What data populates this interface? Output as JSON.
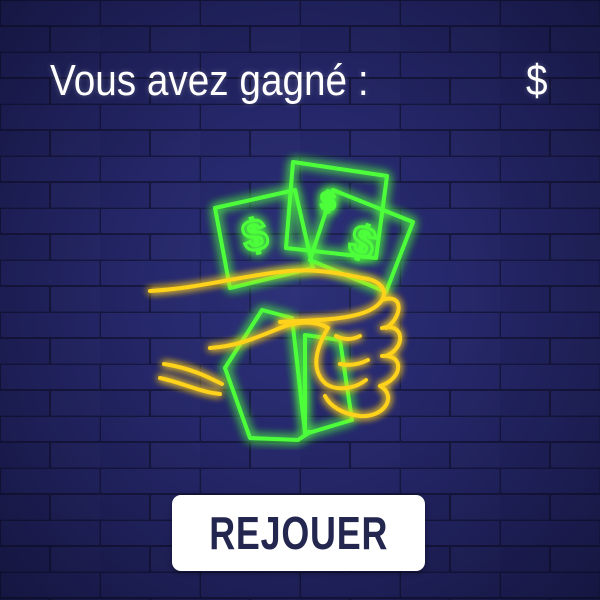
{
  "header": {
    "win_label": "Vous avez gagné :",
    "amount": "",
    "currency": "$"
  },
  "illustration": {
    "icon": "neon-hand-holding-money-icon",
    "bill_symbol": "$",
    "colors": {
      "bills": "#4dff3a",
      "hand": "#ffd21a"
    }
  },
  "actions": {
    "replay_label": "REJOUER"
  },
  "theme": {
    "background": "#1e1f55",
    "button_text": "#23264f"
  }
}
